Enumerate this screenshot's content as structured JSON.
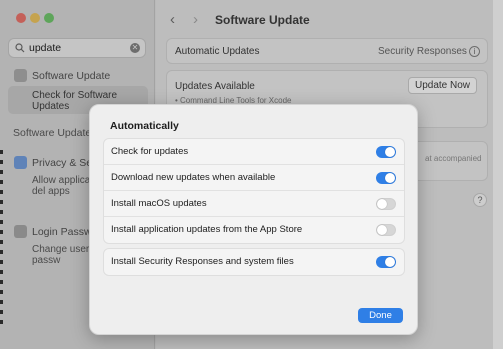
{
  "sidebar": {
    "search": {
      "value": "update",
      "clear_icon": "clear-icon"
    },
    "items": [
      {
        "label": "Software Update",
        "icon": "software-update-icon"
      },
      {
        "label": "Check for Software Updates"
      },
      {
        "label": "Software Update ..."
      },
      {
        "label": "Privacy & Se",
        "icon": "privacy-hand-icon"
      },
      {
        "label": "Allow applica update or del apps"
      },
      {
        "label": "Login Passwo",
        "icon": "login-password-icon"
      },
      {
        "label": "Change user session passw"
      }
    ]
  },
  "main": {
    "title": "Software Update",
    "back_icon": "chevron-left-icon",
    "forward_icon": "chevron-right-icon",
    "automatic_updates": {
      "label": "Automatic Updates",
      "value": "Security Responses"
    },
    "updates_available": {
      "label": "Updates Available",
      "detail": "• Command Line Tools for Xcode",
      "button": "Update Now"
    },
    "partial_text": "at accompanied",
    "help": "?"
  },
  "sheet": {
    "title": "Automatically",
    "options": [
      {
        "label": "Check for updates",
        "state": "on"
      },
      {
        "label": "Download new updates when available",
        "state": "on"
      },
      {
        "label": "Install macOS updates",
        "state": "off"
      },
      {
        "label": "Install application updates from the App Store",
        "state": "off"
      }
    ],
    "security": {
      "label": "Install Security Responses and system files",
      "state": "on"
    },
    "done": "Done"
  },
  "colors": {
    "accent": "#2f7fe6"
  }
}
